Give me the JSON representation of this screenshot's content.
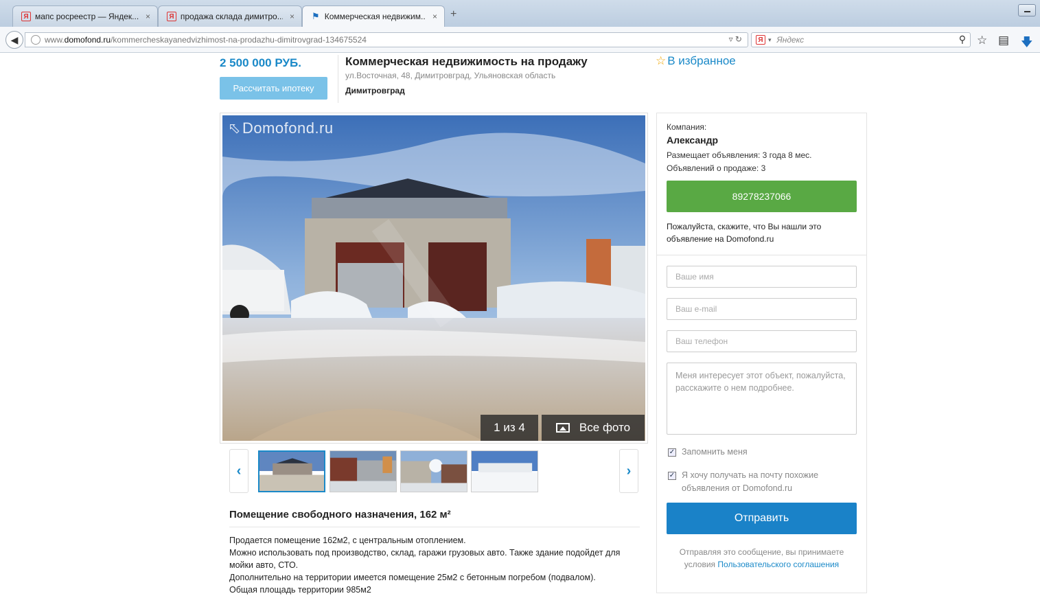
{
  "browser": {
    "tabs": [
      {
        "label": "мапс росреестр — Яндек...",
        "icon": "yandex-icon",
        "active": false
      },
      {
        "label": "продажа склада димитро...",
        "icon": "yandex-icon",
        "active": false
      },
      {
        "label": "Коммерческая недвижим...",
        "icon": "bookmark-icon",
        "active": true
      }
    ],
    "new_tab": "+",
    "close_glyph": "×",
    "url_prefix": "www.",
    "url_domain": "domofond.ru",
    "url_path": "/kommercheskayanedvizhimost-na-prodazhu-dimitrovgrad-134675524",
    "search_placeholder": "Яндекс",
    "search_engine_badge": "Я"
  },
  "listing": {
    "price": "2 500 000 РУБ.",
    "calc_button": "Рассчитать ипотеку",
    "title": "Коммерческая недвижимость на продажу",
    "address": "ул.Восточная, 48, Димитровград, Ульяновская область",
    "city": "Димитровград",
    "favorite": "В избранное"
  },
  "gallery": {
    "watermark": "Domofond.ru",
    "counter": "1 из 4",
    "all_photos": "Все фото",
    "thumb_count": 4,
    "selected_index": 0
  },
  "description": {
    "heading": "Помещение свободного назначения, 162 м²",
    "lines": [
      "Продается помещение 162м2, с центральным отоплением.",
      "Можно использовать под производство, склад, гаражи грузовых авто. Также здание подойдет для мойки авто, СТО.",
      "Дополнительно на территории имеется помещение 25м2 с бетонным погребом (подвалом).",
      "Общая площадь территории 985м2"
    ]
  },
  "contact": {
    "company_label": "Компания:",
    "name": "Александр",
    "since": "Размещает объявления: 3 года 8 мес.",
    "ads_count": "Объявлений о продаже: 3",
    "phone": "89278237066",
    "note": "Пожалуйста, скажите, что Вы нашли это объявление на Domofond.ru",
    "form": {
      "name_placeholder": "Ваше имя",
      "email_placeholder": "Ваш e-mail",
      "phone_placeholder": "Ваш телефон",
      "message": "Меня интересует этот объект, пожалуйста, расскажите о нем подробнее.",
      "remember_me": "Запомнить меня",
      "remember_checked": true,
      "subscribe": "Я хочу получать на почту похожие объявления от Domofond.ru",
      "subscribe_checked": true,
      "submit": "Отправить"
    },
    "legal_text": "Отправляя это сообщение, вы принимаете условия",
    "legal_link": "Пользовательского соглашения"
  },
  "colors": {
    "accent": "#1a89c8",
    "phone_button": "#59a944",
    "submit_button": "#1a82c8",
    "calc_button": "#7ac2e8"
  }
}
